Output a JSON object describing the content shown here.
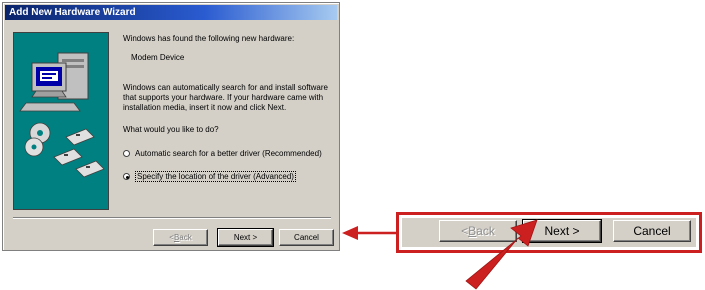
{
  "window": {
    "title": "Add New Hardware Wizard"
  },
  "content": {
    "found_line": "Windows has found the following new hardware:",
    "device_name": "Modem Device",
    "info": "Windows can automatically search for and install software that supports your hardware. If your hardware came with installation media, insert it now and click Next.",
    "question": "What would you like to do?",
    "options": [
      {
        "label": "Automatic search for a better driver (Recommended)",
        "selected": false
      },
      {
        "label": "Specify the location of the driver (Advanced)",
        "selected": true
      }
    ]
  },
  "buttons": {
    "back": {
      "prefix": "< ",
      "accel": "B",
      "rest": "ack",
      "enabled": false
    },
    "next": {
      "label": "Next >",
      "default": true
    },
    "cancel": {
      "label": "Cancel"
    }
  },
  "callout": {
    "back": {
      "prefix": "< ",
      "accel": "B",
      "rest": "ack"
    },
    "next": {
      "label": "Next >"
    },
    "cancel": {
      "label": "Cancel"
    }
  },
  "colors": {
    "titlebar": "#0a246a",
    "dialog_bg": "#d4d0c8",
    "art_bg": "#008080",
    "callout_red": "#cc1f1f"
  }
}
